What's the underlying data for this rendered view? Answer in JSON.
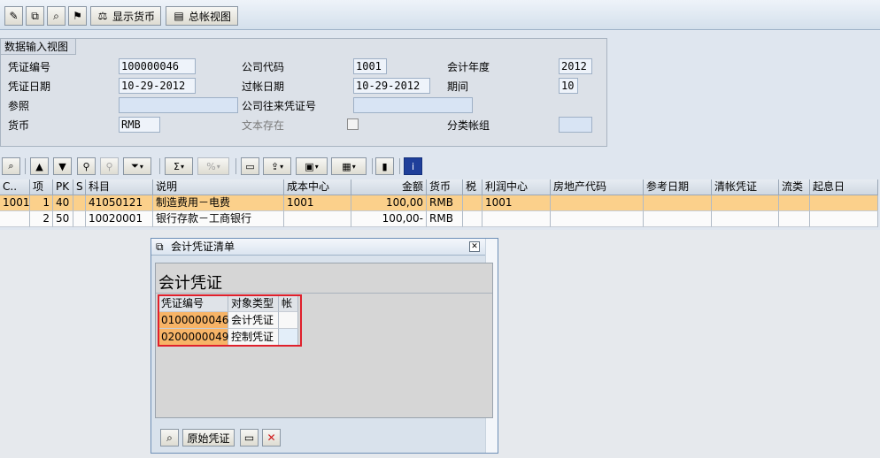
{
  "toolbar": {
    "display_currency_label": "显示货币",
    "general_ledger_view_label": "总帐视图",
    "icons": [
      "edit-icon",
      "other-document-icon",
      "display-document-icon",
      "hold-icon",
      "display-currency-icon",
      "general-ledger-view-icon"
    ]
  },
  "header": {
    "tab_label": "数据输入视图",
    "fields": {
      "doc_number": {
        "label": "凭证编号",
        "value": "100000046"
      },
      "company_code": {
        "label": "公司代码",
        "value": "1001"
      },
      "fiscal_year": {
        "label": "会计年度",
        "value": "2012"
      },
      "doc_date": {
        "label": "凭证日期",
        "value": "10-29-2012"
      },
      "posting_date": {
        "label": "过帐日期",
        "value": "10-29-2012"
      },
      "period": {
        "label": "期间",
        "value": "10"
      },
      "reference": {
        "label": "参照",
        "value": ""
      },
      "cross_company": {
        "label": "公司往来凭证号",
        "value": ""
      },
      "currency": {
        "label": "货币",
        "value": "RMB"
      },
      "text_exists": {
        "label": "文本存在",
        "checked": false
      },
      "ledger_group": {
        "label": "分类帐组",
        "value": ""
      }
    }
  },
  "grid": {
    "columns": [
      "C..",
      "项",
      "PK",
      "S",
      "科目",
      "说明",
      "成本中心",
      "金额",
      "货币",
      "税",
      "利润中心",
      "房地产代码",
      "参考日期",
      "清帐凭证",
      "流类",
      "起息日"
    ],
    "rows": [
      {
        "c": "1001",
        "item": "1",
        "pk": "40",
        "s": "",
        "account": "41050121",
        "description": "制造费用－电费",
        "cost_center": "1001",
        "amount": "100,00",
        "currency": "RMB",
        "tax": "",
        "profit_center": "1001",
        "real_estate": "",
        "ref_date": "",
        "clearing_doc": "",
        "flow_type": "",
        "value_date": ""
      },
      {
        "c": "",
        "item": "2",
        "pk": "50",
        "s": "",
        "account": "10020001",
        "description": "银行存款－工商银行",
        "cost_center": "",
        "amount": "100,00-",
        "currency": "RMB",
        "tax": "",
        "profit_center": "",
        "real_estate": "",
        "ref_date": "",
        "clearing_doc": "",
        "flow_type": "",
        "value_date": ""
      }
    ]
  },
  "dialog": {
    "title": "会计凭证清单",
    "heading": "会计凭证",
    "columns": [
      "凭证编号",
      "对象类型",
      "帐"
    ],
    "rows": [
      {
        "doc_number": "0100000046",
        "object_type": "会计凭证",
        "account": ""
      },
      {
        "doc_number": "0200000049",
        "object_type": "控制凭证",
        "account": ""
      }
    ],
    "original_doc_button": "原始凭证"
  },
  "colors": {
    "selected_row": "#fbd08b",
    "key_cell": "#f7b467",
    "highlight_box": "#e0202c",
    "toolbar_bg": "#dce6f0"
  }
}
